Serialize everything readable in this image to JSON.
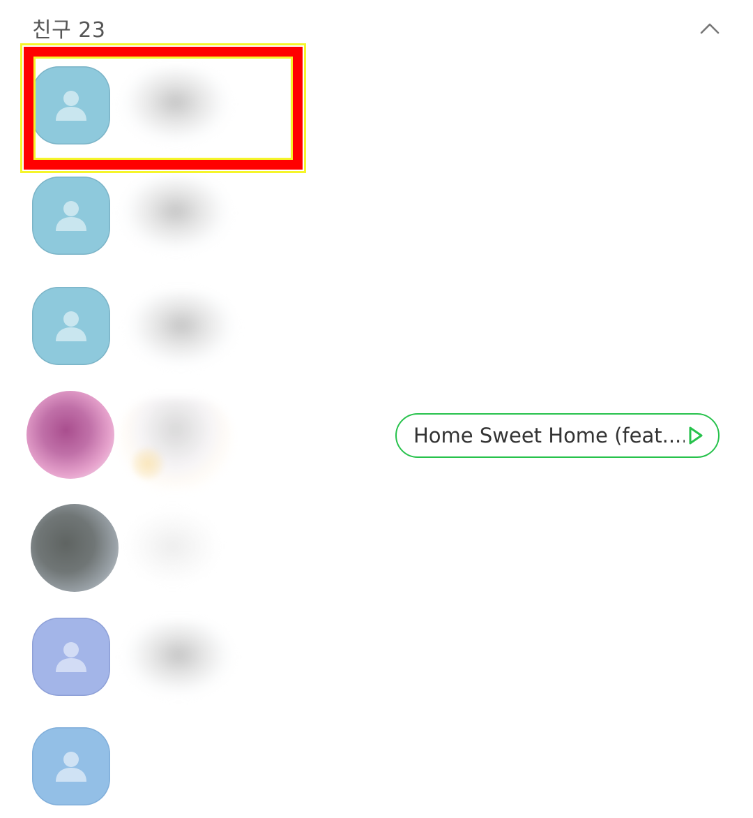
{
  "header": {
    "section_title": "친구 23",
    "collapse_icon": "chevron-up-icon"
  },
  "friends": [
    {
      "avatar": "default-profile",
      "color": "#8ec9dc"
    },
    {
      "avatar": "default-profile",
      "color": "#8ec9dc"
    },
    {
      "avatar": "default-profile",
      "color": "#8ec9dc"
    },
    {
      "avatar": "photo",
      "color": "#c070a8"
    },
    {
      "avatar": "photo",
      "color": "#707676"
    },
    {
      "avatar": "default-profile",
      "color": "#a3b5e8"
    },
    {
      "avatar": "default-profile",
      "color": "#93bfe6"
    }
  ],
  "music": {
    "song_label": "Home Sweet Home (feat....",
    "accent": "#27c24c",
    "icon": "play-icon"
  },
  "highlight": {
    "color_outer": "#ff0000",
    "color_edge": "#f5f52a"
  }
}
